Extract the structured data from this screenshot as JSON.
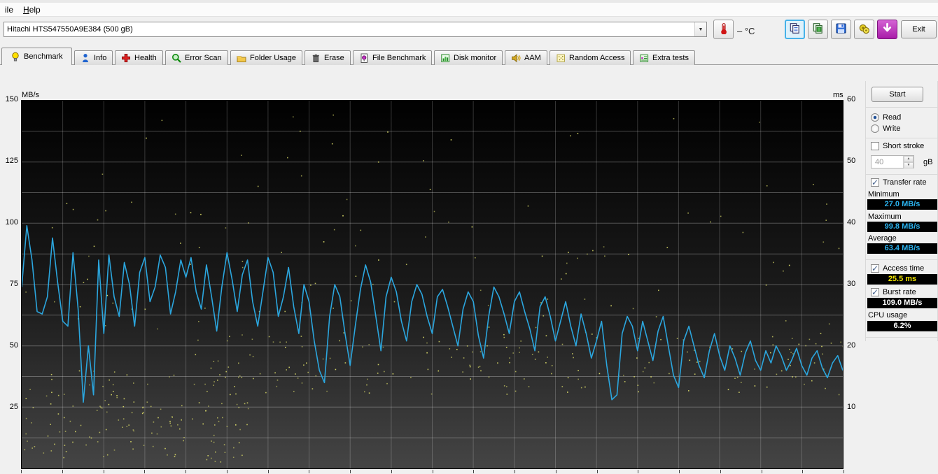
{
  "header": {
    "menu": [
      {
        "label": "ile",
        "name": "menu-file"
      },
      {
        "label": "Help",
        "name": "menu-help"
      }
    ],
    "drive_selector_value": "Hitachi HTS547550A9E384  (500 gB)",
    "temperature_value": "– °C",
    "exit_label": "Exit"
  },
  "toolbar_icons": [
    "thermometer",
    "copy-blue",
    "copy-green",
    "save",
    "options",
    "download"
  ],
  "tabs": {
    "active_index": 0,
    "items": [
      {
        "label": "Benchmark",
        "icon": "benchmark"
      },
      {
        "label": "Info",
        "icon": "info"
      },
      {
        "label": "Health",
        "icon": "health"
      },
      {
        "label": "Error Scan",
        "icon": "error-scan"
      },
      {
        "label": "Folder Usage",
        "icon": "folder"
      },
      {
        "label": "Erase",
        "icon": "erase"
      },
      {
        "label": "File Benchmark",
        "icon": "file-benchmark"
      },
      {
        "label": "Disk monitor",
        "icon": "disk-monitor"
      },
      {
        "label": "AAM",
        "icon": "aam"
      },
      {
        "label": "Random Access",
        "icon": "random-access"
      },
      {
        "label": "Extra tests",
        "icon": "extra-tests"
      }
    ]
  },
  "panel": {
    "start_label": "Start",
    "read_label": "Read",
    "write_label": "Write",
    "read_selected": true,
    "short_stroke_label": "Short stroke",
    "short_stroke_checked": false,
    "capacity_value": "40",
    "capacity_unit": "gB",
    "transfer_rate_label": "Transfer rate",
    "transfer_rate_checked": true,
    "minimum_label": "Minimum",
    "minimum_value": "27.0 MB/s",
    "maximum_label": "Maximum",
    "maximum_value": "99.8 MB/s",
    "average_label": "Average",
    "average_value": "63.4 MB/s",
    "access_time_label": "Access time",
    "access_time_value": "25.5 ms",
    "access_time_checked": true,
    "burst_rate_label": "Burst rate",
    "burst_rate_value": "109.0 MB/s",
    "burst_rate_checked": true,
    "cpu_usage_label": "CPU usage",
    "cpu_usage_value": "6.2%"
  },
  "chart_data": {
    "type": "line",
    "title": "HD Tune read benchmark: transfer rate line (MB/s, left axis) with access-time scatter (ms, right axis)",
    "left_axis": {
      "label": "MB/s",
      "min": 0,
      "max": 150,
      "ticks": [
        150,
        125,
        100,
        75,
        50,
        25
      ],
      "minor_step": 12.5
    },
    "right_axis": {
      "label": "ms",
      "min": 0,
      "max": 60,
      "ticks": [
        60,
        50,
        40,
        30,
        20,
        10
      ]
    },
    "x_axis": {
      "min": 0,
      "max": 500,
      "unit": "gB",
      "divisions": 20
    },
    "grid": true,
    "series": [
      {
        "name": "Transfer rate (MB/s)",
        "values": [
          74,
          99,
          85,
          64,
          63,
          70,
          94,
          76,
          60,
          58,
          88,
          65,
          27,
          50,
          30,
          85,
          55,
          87,
          70,
          62,
          84,
          75,
          58,
          80,
          86,
          68,
          74,
          87,
          82,
          63,
          72,
          85,
          78,
          86,
          72,
          65,
          83,
          70,
          56,
          74,
          88,
          77,
          64,
          79,
          85,
          68,
          58,
          72,
          86,
          80,
          62,
          70,
          82,
          66,
          55,
          75,
          68,
          52,
          40,
          35,
          62,
          75,
          70,
          55,
          42,
          58,
          73,
          83,
          76,
          62,
          48,
          70,
          78,
          72,
          60,
          52,
          68,
          75,
          71,
          62,
          55,
          70,
          73,
          66,
          58,
          50,
          65,
          72,
          68,
          54,
          45,
          62,
          74,
          70,
          63,
          55,
          68,
          72,
          64,
          57,
          48,
          66,
          70,
          62,
          52,
          60,
          68,
          58,
          50,
          63,
          55,
          45,
          52,
          60,
          42,
          28,
          30,
          55,
          62,
          58,
          48,
          60,
          52,
          44,
          56,
          62,
          50,
          38,
          33,
          52,
          58,
          50,
          42,
          37,
          48,
          55,
          46,
          40,
          50,
          45,
          38,
          47,
          52,
          44,
          40,
          48,
          43,
          50,
          46,
          40,
          44,
          49,
          42,
          38,
          45,
          48,
          41,
          37,
          43,
          46,
          40
        ]
      }
    ],
    "scatter": {
      "name": "Access time (ms)",
      "seed": 1337,
      "clusters": [
        {
          "count": 150,
          "x_range": [
            0.0,
            0.28
          ],
          "ms_range": [
            1,
            16
          ]
        },
        {
          "count": 190,
          "x_range": [
            0.2,
            1.0
          ],
          "ms_range": [
            12,
            22
          ]
        },
        {
          "count": 90,
          "x_range": [
            0.0,
            1.0
          ],
          "ms_range": [
            22,
            42
          ]
        },
        {
          "count": 30,
          "x_range": [
            0.0,
            1.0
          ],
          "ms_range": [
            42,
            58
          ]
        }
      ]
    },
    "colors": {
      "line": "#2ba6de",
      "scatter": "#d9d968",
      "grid": "rgba(255,255,255,0.28)",
      "plot_bg_top": "#010101",
      "plot_bg_bottom": "#454545",
      "value_transfer": "#2bb3ef",
      "value_access": "#f0e400",
      "value_white": "#ffffff"
    }
  }
}
